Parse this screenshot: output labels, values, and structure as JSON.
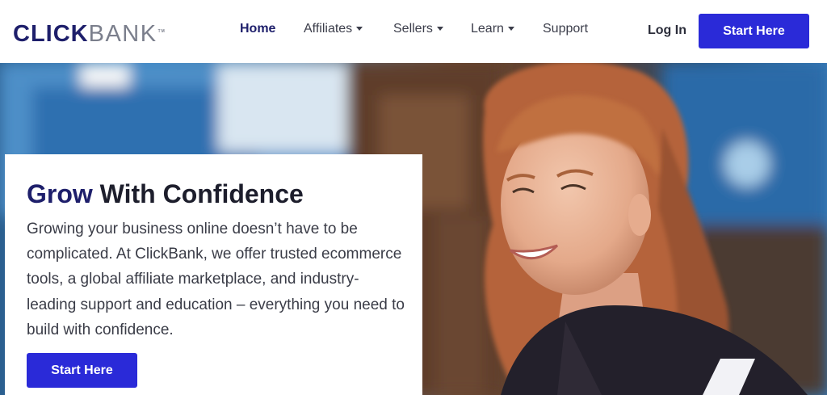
{
  "header": {
    "logo": {
      "part1": "CLICK",
      "part2": "BANK",
      "tm": "TM"
    },
    "nav": [
      {
        "label": "Home",
        "active": true,
        "dropdown": false
      },
      {
        "label": "Affiliates",
        "active": false,
        "dropdown": true
      },
      {
        "label": "Sellers",
        "active": false,
        "dropdown": true
      },
      {
        "label": "Learn",
        "active": false,
        "dropdown": true
      },
      {
        "label": "Support",
        "active": false,
        "dropdown": false
      }
    ],
    "login_label": "Log In",
    "cta_label": "Start Here"
  },
  "hero": {
    "title_strong": "Grow",
    "title_rest": " With Confidence",
    "body": "Growing your business online doesn’t have to be complicated. At ClickBank, we offer trusted ecommerce tools, a global affiliate marketplace, and industry-leading support and education – everything you need to build with confidence.",
    "cta_label": "Start Here"
  },
  "colors": {
    "brand_navy": "#1e1f6b",
    "cta_blue": "#2a2ad8",
    "logo_gray": "#7b7f8c"
  }
}
